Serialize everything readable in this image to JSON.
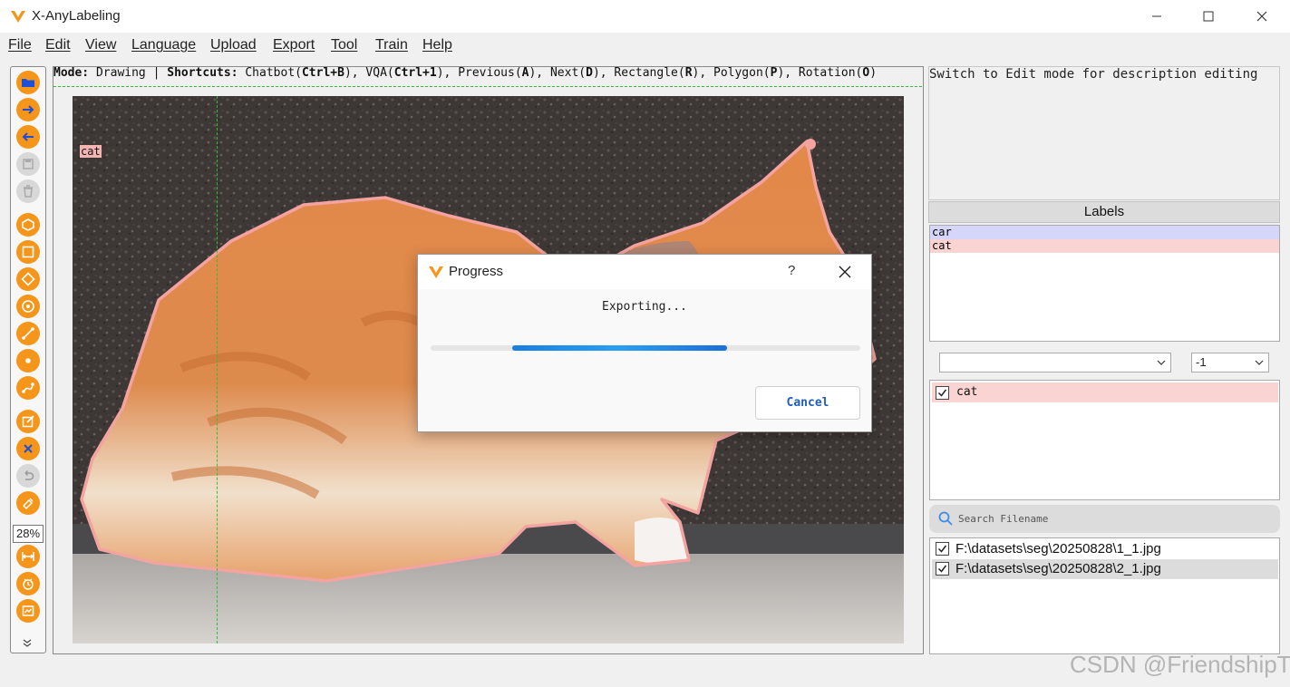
{
  "window": {
    "title": "X-AnyLabeling",
    "controls": {
      "minimize_icon": "minimize-icon",
      "maximize_icon": "maximize-icon",
      "close_icon": "close-icon"
    }
  },
  "menu": [
    "File",
    "Edit",
    "View",
    "Language",
    "Upload",
    "Export",
    "Tool",
    "Train",
    "Help"
  ],
  "toolbar": {
    "icons": [
      "open-dir-icon",
      "next-image-icon",
      "prev-image-icon",
      "save-icon",
      "delete-file-icon",
      "polygon-icon",
      "rectangle-icon",
      "rotation-icon",
      "circle-icon",
      "line-icon",
      "point-icon",
      "linestrip-icon",
      "edit-icon",
      "delete-shape-icon",
      "undo-icon",
      "brightness-icon",
      "fit-width-icon",
      "auto-icon",
      "ai-icon"
    ],
    "zoom": "28%",
    "more_icon": "chevron-down-icon"
  },
  "status": {
    "mode_prefix": "Mode:",
    "mode": "Drawing",
    "separator": "|",
    "shortcuts_prefix": "Shortcuts:",
    "shortcuts": [
      {
        "name": "Chatbot",
        "key": "Ctrl+B"
      },
      {
        "name": "VQA",
        "key": "Ctrl+1"
      },
      {
        "name": "Previous",
        "key": "A"
      },
      {
        "name": "Next",
        "key": "D"
      },
      {
        "name": "Rectangle",
        "key": "R"
      },
      {
        "name": "Polygon",
        "key": "P"
      },
      {
        "name": "Rotation",
        "key": "O"
      }
    ]
  },
  "canvas": {
    "shape_label": "cat"
  },
  "dialog": {
    "title": "Progress",
    "help": "?",
    "message": "Exporting...",
    "progress": {
      "start": 0.19,
      "end": 0.69
    },
    "cancel": "Cancel"
  },
  "panel": {
    "description_hint": "Switch to Edit mode for description editing",
    "labels_title": "Labels",
    "labels": [
      {
        "name": "car",
        "color": "#d6d6fa"
      },
      {
        "name": "cat",
        "color": "#fad3d3"
      }
    ],
    "combo_left": "",
    "combo_right": "-1",
    "shapes": [
      {
        "label": "cat",
        "checked": true,
        "color": "#fad3d3"
      }
    ],
    "search_placeholder": "Search Filename",
    "files": [
      {
        "path": "F:\\datasets\\seg\\20250828\\1_1.jpg",
        "checked": true
      },
      {
        "path": "F:\\datasets\\seg\\20250828\\2_1.jpg",
        "checked": true
      }
    ]
  },
  "colors": {
    "accent": "#f5951a",
    "polygon": "#f3a3a0",
    "guide": "#2ec02e",
    "progress": "#1a7fe0"
  },
  "watermark": "CSDN @FriendshipT"
}
